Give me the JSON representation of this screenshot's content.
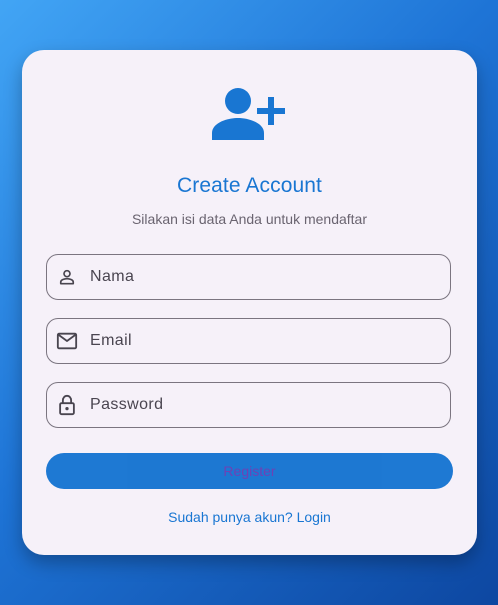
{
  "title": "Create Account",
  "subtitle": "Silakan isi data Anda untuk mendaftar",
  "fields": {
    "name": {
      "placeholder": "Nama",
      "value": "",
      "icon": "person-outline-icon"
    },
    "email": {
      "placeholder": "Email",
      "value": "",
      "icon": "mail-outline-icon"
    },
    "password": {
      "placeholder": "Password",
      "value": "",
      "icon": "lock-outline-icon"
    }
  },
  "header_icon": "person-add-icon",
  "register_label": "Register",
  "login_link": "Sudah punya akun? Login",
  "colors": {
    "primary": "#1976d2",
    "card": "#f6f1f9",
    "background_start": "#42a5f5",
    "background_end": "#0d47a1"
  }
}
